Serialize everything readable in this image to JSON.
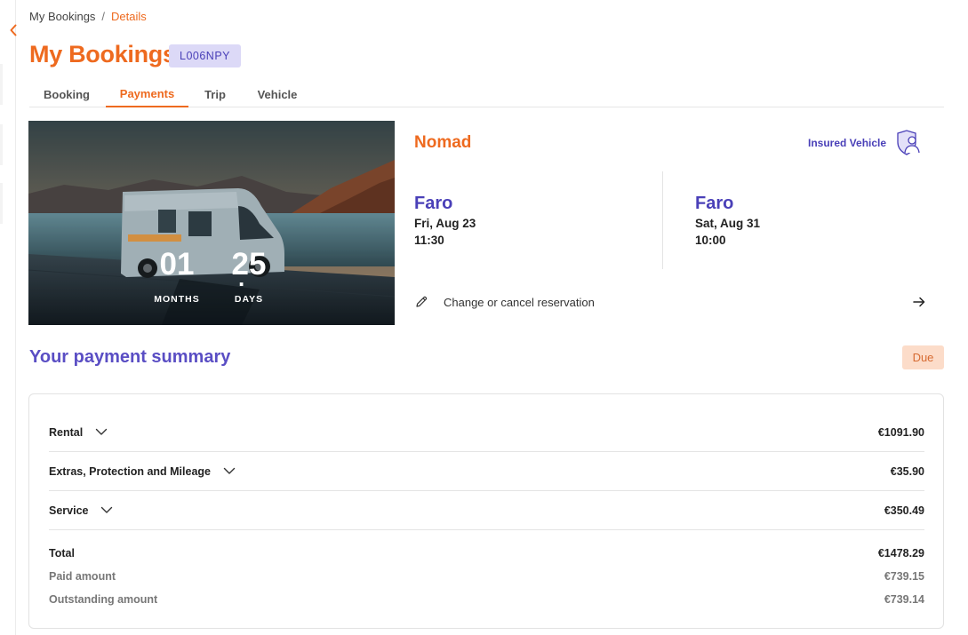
{
  "breadcrumb": {
    "root": "My Bookings",
    "separator": "/",
    "current": "Details"
  },
  "header": {
    "title": "My Bookings",
    "booking_code": "L006NPY"
  },
  "tabs": [
    {
      "label": "Booking"
    },
    {
      "label": "Payments"
    },
    {
      "label": "Trip"
    },
    {
      "label": "Vehicle"
    }
  ],
  "active_tab": "Payments",
  "countdown": {
    "months": "01",
    "separator": ".",
    "days": "25",
    "months_label": "MONTHS",
    "days_label": "DAYS"
  },
  "vehicle": {
    "name": "Nomad",
    "insured_label": "Insured Vehicle"
  },
  "pickup": {
    "city": "Faro",
    "date": "Fri, Aug 23",
    "time": "11:30"
  },
  "dropoff": {
    "city": "Faro",
    "date": "Sat, Aug 31",
    "time": "10:00"
  },
  "actions": {
    "change_label": "Change or cancel reservation"
  },
  "summary": {
    "title": "Your payment summary",
    "status": "Due",
    "items": [
      {
        "label": "Rental",
        "amount": "€1091.90"
      },
      {
        "label": "Extras, Protection and Mileage",
        "amount": "€35.90"
      },
      {
        "label": "Service",
        "amount": "€350.49"
      }
    ],
    "total": {
      "label": "Total",
      "amount": "€1478.29"
    },
    "paid": {
      "label": "Paid amount",
      "amount": "€739.15"
    },
    "outstanding": {
      "label": "Outstanding amount",
      "amount": "€739.14"
    }
  },
  "colors": {
    "accent": "#ee6a1f",
    "brand_purple": "#4a40b8",
    "badge_bg": "#dcd9f7",
    "due_bg": "#fcdcc9"
  },
  "icons": {
    "back": "chevron-left-icon",
    "edit": "pencil-icon",
    "arrow": "arrow-right-icon",
    "insured": "shield-user-icon",
    "expand": "chevron-down-icon"
  }
}
